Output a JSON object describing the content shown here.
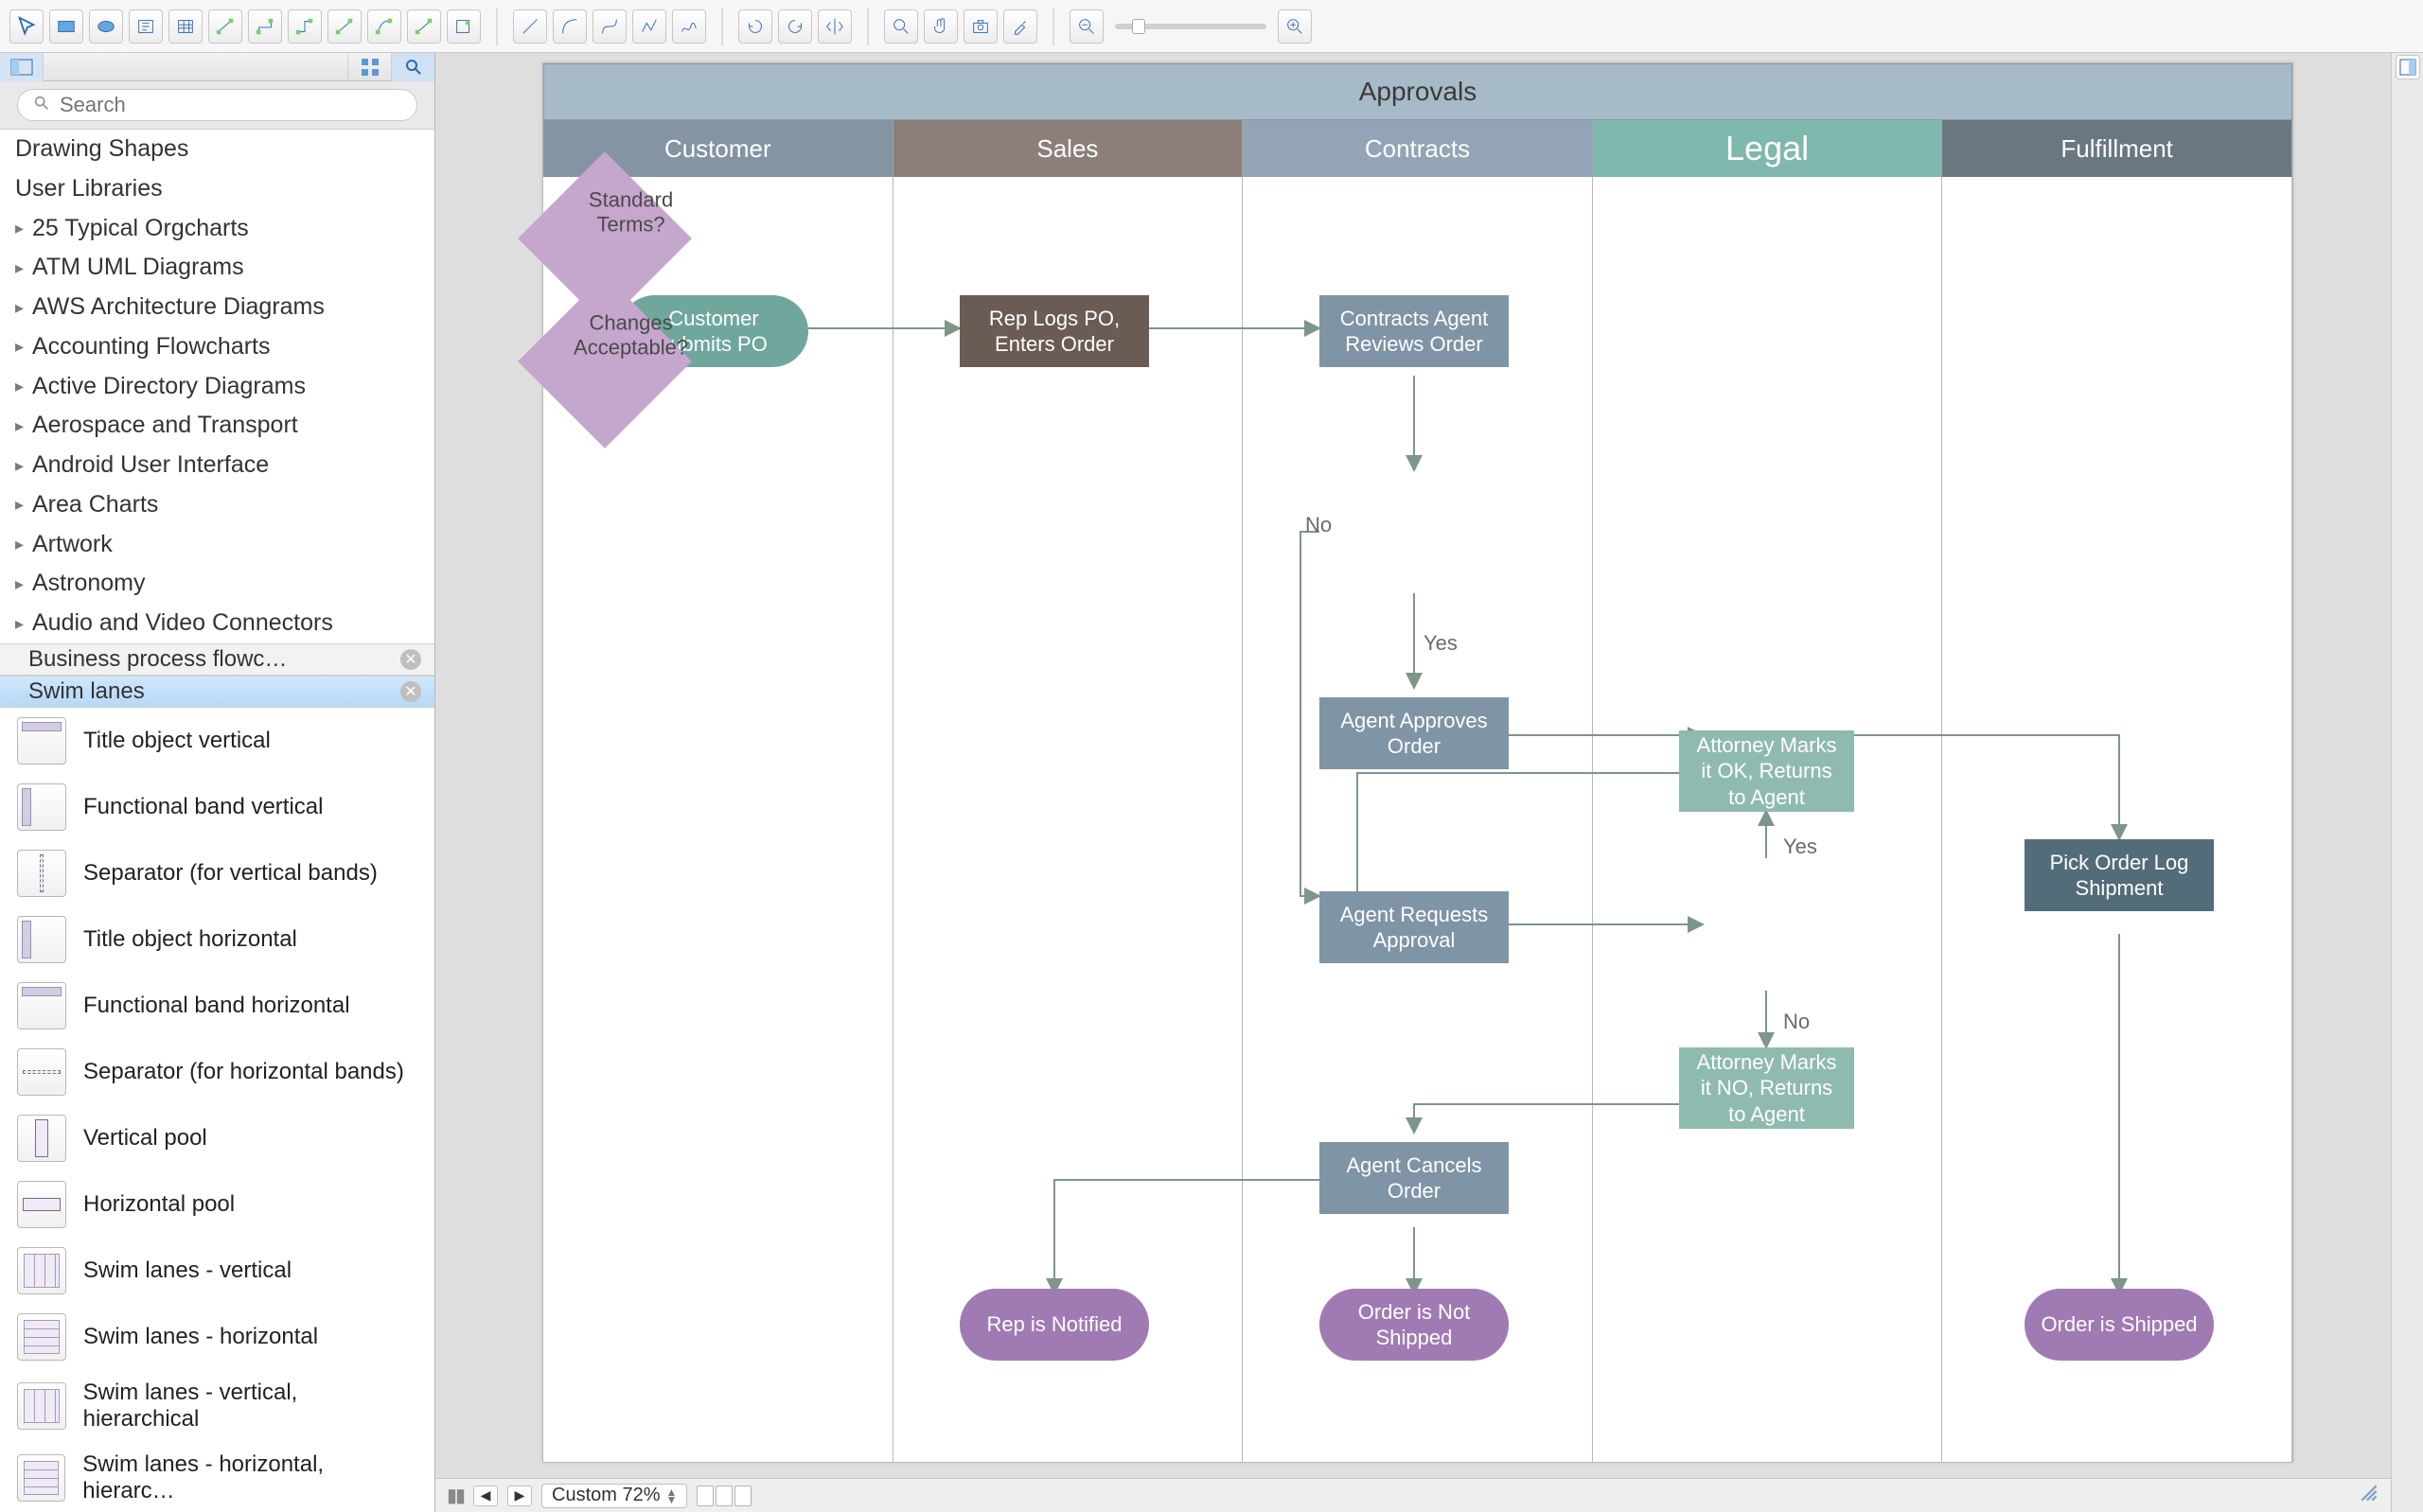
{
  "toolbar": {
    "groups": [
      [
        "pointer",
        "rectangle",
        "ellipse",
        "text",
        "table",
        "orgchart",
        "connector-straight",
        "connector-route1",
        "connector-route2",
        "connector-route3",
        "connector-spline",
        "export"
      ],
      [
        "line",
        "arc",
        "bezier",
        "polyline",
        "freehand"
      ],
      [
        "rotate-left",
        "rotate-right",
        "flip"
      ],
      [
        "zoom-fit",
        "pan",
        "snapshot",
        "eyedropper"
      ],
      [
        "zoom-out",
        "zoom-slider",
        "zoom-in"
      ]
    ]
  },
  "left_panel": {
    "search_placeholder": "Search",
    "toplevel": [
      "Drawing Shapes",
      "User Libraries"
    ],
    "libraries": [
      "25 Typical Orgcharts",
      "ATM UML Diagrams",
      "AWS Architecture Diagrams",
      "Accounting Flowcharts",
      "Active Directory Diagrams",
      "Aerospace and Transport",
      "Android User Interface",
      "Area Charts",
      "Artwork",
      "Astronomy",
      "Audio and Video Connectors"
    ],
    "stencil_tabs": [
      {
        "label": "Business process flowc…",
        "active": false
      },
      {
        "label": "Swim lanes",
        "active": true
      }
    ],
    "shapes": [
      "Title object vertical",
      "Functional band vertical",
      "Separator (for vertical bands)",
      "Title object horizontal",
      "Functional band horizontal",
      "Separator (for horizontal bands)",
      "Vertical pool",
      "Horizontal pool",
      "Swim lanes - vertical",
      "Swim lanes - horizontal",
      "Swim lanes - vertical, hierarchical",
      "Swim lanes - horizontal, hierarc…"
    ]
  },
  "diagram": {
    "title": "Approvals",
    "lanes": [
      "Customer",
      "Sales",
      "Contracts",
      "Legal",
      "Fulfillment"
    ],
    "nodes": {
      "n1": "Customer submits PO",
      "n2": "Rep Logs PO, Enters Order",
      "n3": "Contracts Agent Reviews Order",
      "n4": "Standard Terms?",
      "n5": "Agent Approves Order",
      "n6": "Agent Requests Approval",
      "n7": "Changes Acceptable?",
      "n8": "Attorney Marks it OK, Returns to Agent",
      "n9": "Attorney Marks it NO, Returns to Agent",
      "n10": "Agent Cancels Order",
      "n11": "Rep is Notified",
      "n12": "Order is Not Shipped",
      "n13": "Pick Order Log Shipment",
      "n14": "Order is Shipped"
    },
    "labels": {
      "no1": "No",
      "yes1": "Yes",
      "yes2": "Yes",
      "no2": "No"
    }
  },
  "bottom": {
    "zoom": "Custom 72%"
  }
}
